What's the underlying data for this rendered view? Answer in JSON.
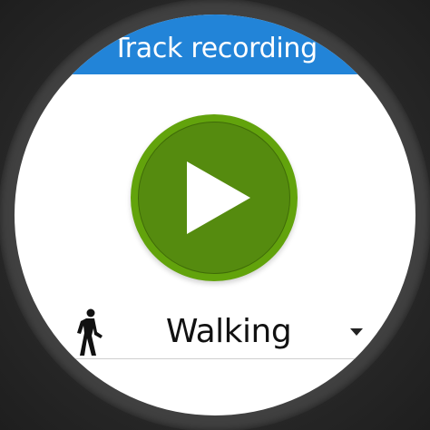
{
  "header": {
    "title": "Track recording"
  },
  "record": {
    "icon": "play-icon"
  },
  "activity": {
    "icon": "walking-person-icon",
    "selected": "Walking",
    "dropdown_icon": "dropdown-triangle-icon"
  },
  "colors": {
    "title_bar": "#2284d8",
    "play_outer": "#62a30c",
    "play_inner": "#558b0f",
    "face_background": "#ffffff"
  }
}
